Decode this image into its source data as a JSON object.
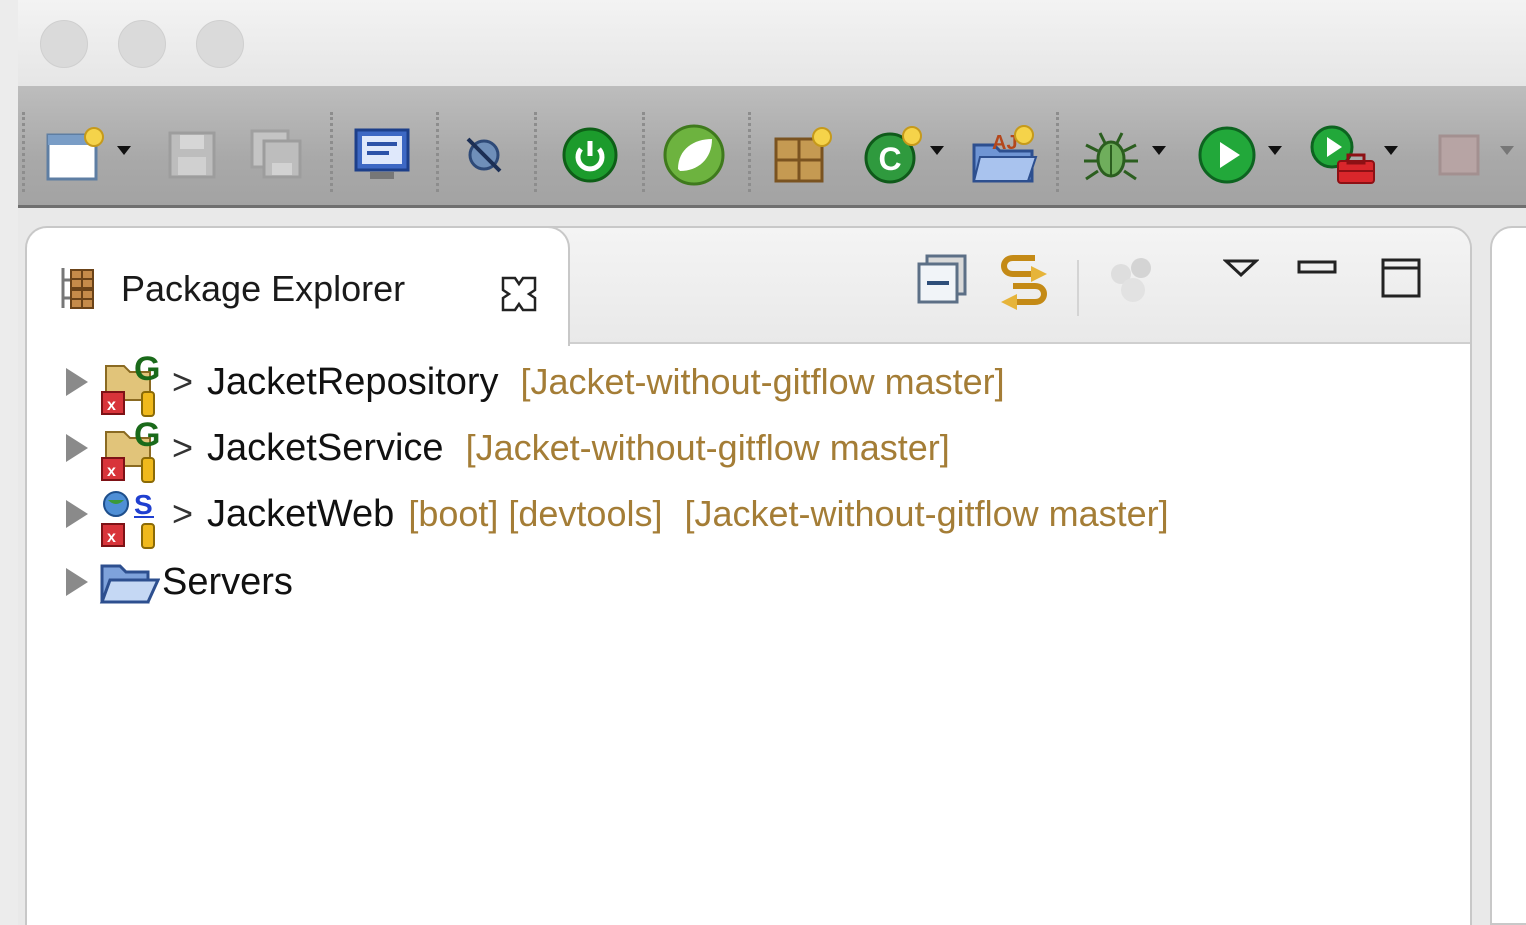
{
  "panel": {
    "title": "Package Explorer"
  },
  "tree": [
    {
      "name": "JacketRepository",
      "git_marker": ">",
      "decorations": "[Jacket-without-gitflow master]",
      "icon": "gradle-project-error-icon"
    },
    {
      "name": "JacketService",
      "git_marker": ">",
      "decorations": "[Jacket-without-gitflow master]",
      "icon": "gradle-project-error-icon"
    },
    {
      "name": "JacketWeb",
      "git_marker": ">",
      "tags": "[boot] [devtools]",
      "decorations": "[Jacket-without-gitflow master]",
      "icon": "spring-web-project-error-icon"
    },
    {
      "name": "Servers",
      "icon": "folder-open-icon"
    }
  ],
  "colors": {
    "toolbar": "#a9a9a9",
    "decoration_text": "#a47d36",
    "panel_border": "#c8c8c8"
  }
}
